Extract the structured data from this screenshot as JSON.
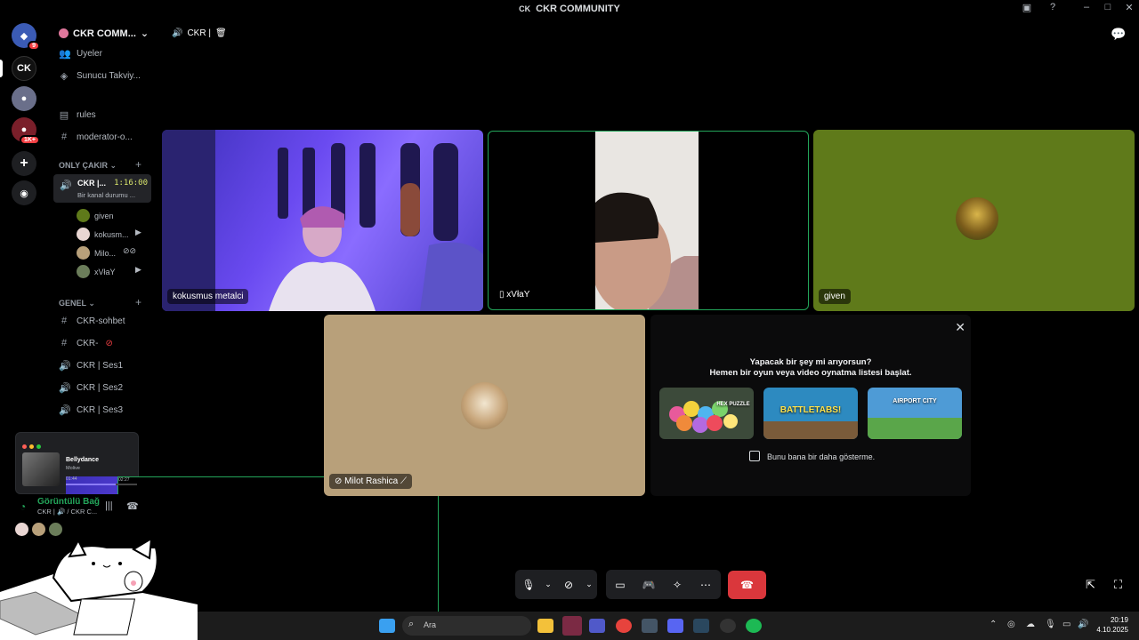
{
  "window": {
    "title": "CKR COMMUNITY",
    "logo": "CK"
  },
  "rail": {
    "badge1": "9",
    "badge2": "1K+"
  },
  "sidebar": {
    "server_name": "CKR COMM...",
    "items_top": [
      {
        "icon": "members-icon",
        "label": "Uyeler"
      },
      {
        "icon": "boost-icon",
        "label": "Sunucu Takviy..."
      },
      {
        "icon": "rules-icon",
        "label": "rules"
      },
      {
        "icon": "hash-icon",
        "label": "moderator-o..."
      }
    ],
    "category_1": "ONLY ÇAKIR",
    "active_channel": {
      "name": "CKR |...",
      "time": "1:16:00",
      "status": "Bir kanal durumu ..."
    },
    "members": [
      {
        "name": "given",
        "color": "#5f7a1a"
      },
      {
        "name": "kokusm...",
        "color": "#e9d6d3"
      },
      {
        "name": "Milo...",
        "color": "#b8a07a"
      },
      {
        "name": "xVłaY",
        "color": "#6b7d5a"
      }
    ],
    "category_2": "GENEL",
    "channels": [
      {
        "icon": "hash-icon",
        "label": "CKR-sohbet"
      },
      {
        "icon": "hash-icon",
        "label": "CKR-"
      },
      {
        "icon": "speaker-icon",
        "label": "CKR | Ses1"
      },
      {
        "icon": "speaker-icon",
        "label": "CKR | Ses2"
      },
      {
        "icon": "speaker-icon",
        "label": "CKR | Ses3"
      }
    ]
  },
  "music": {
    "song": "Bellydance",
    "artist": "Molive",
    "elapsed": "01:44",
    "total": "02:27",
    "progress": 0.7
  },
  "voice": {
    "status": "Görüntülü Bağ",
    "channel": "CKR | 🔊 / CKR C..."
  },
  "main": {
    "channel_header": "CKR |",
    "tiles": [
      {
        "label": "kokusmus metalci"
      },
      {
        "label": "xVłaY"
      },
      {
        "label": "given"
      },
      {
        "label": "Milot Rashica"
      }
    ]
  },
  "promo": {
    "heading1": "Yapacak bir şey mi arıyorsun?",
    "heading2": "Hemen bir oyun veya video oynatma listesi başlat.",
    "games": [
      {
        "name": "HEX PUZZLE",
        "color": "#3c4a3a"
      },
      {
        "name": "BATTLETABS!",
        "color": "#2d8ac0"
      },
      {
        "name": "AIRPORT CITY",
        "color": "#4e9bd6"
      }
    ],
    "checkbox_label": "Bunu bana bir daha gösterme."
  },
  "taskbar": {
    "search_placeholder": "Ara",
    "time": "20:19",
    "date": "4.10.2025"
  }
}
